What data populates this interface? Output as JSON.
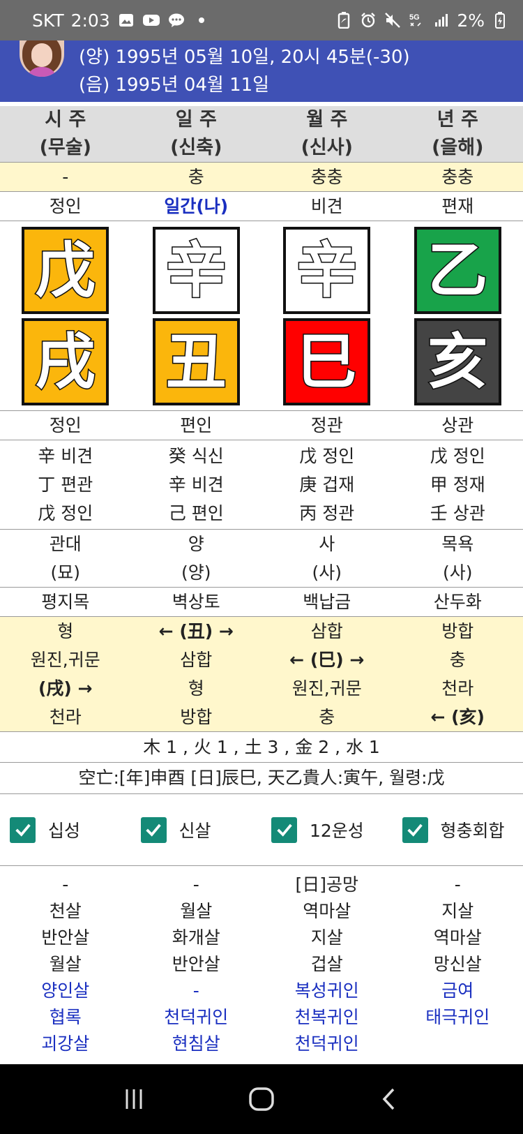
{
  "status": {
    "carrier": "SKT",
    "time": "2:03",
    "battery": "2%",
    "icons_left": [
      "image-icon",
      "youtube-icon",
      "chat-icon",
      "dot-icon"
    ],
    "icons_right": [
      "battery-saver-icon",
      "alarm-icon",
      "mute-icon",
      "5g-icon",
      "signal-icon",
      "battery-icon"
    ]
  },
  "header": {
    "solar": "(양) 1995년 05월 10일, 20시 45분(-30)",
    "lunar": "(음) 1995년 04월 11일"
  },
  "columns": [
    {
      "title": "시 주",
      "sub": "(무술)",
      "clash": "-",
      "stem_god": "정인",
      "stem": {
        "char": "戊",
        "color": "#fbb60c"
      },
      "branch": {
        "char": "戌",
        "color": "#fbb60c"
      },
      "branch_god": "정인",
      "hidden": [
        "辛 비견",
        "丁 편관",
        "戊 정인"
      ],
      "stage": "관대",
      "stage_sub": "(묘)",
      "nayin": "평지목",
      "relations": [
        "형",
        "원진,귀문",
        "(戌) →",
        "천라"
      ],
      "rel_bold": [
        false,
        false,
        true,
        false
      ],
      "sinsal_top": "-",
      "sinsal": [
        "천살",
        "반안살",
        "월살"
      ],
      "gwiin": [
        "양인살",
        "협록",
        "괴강살"
      ]
    },
    {
      "title": "일 주",
      "sub": "(신축)",
      "clash": "충",
      "stem_god": "일간(나)",
      "stem": {
        "char": "辛",
        "color": "#ffffff"
      },
      "branch": {
        "char": "丑",
        "color": "#fbb60c"
      },
      "branch_god": "편인",
      "hidden": [
        "癸 식신",
        "辛 비견",
        "己 편인"
      ],
      "stage": "양",
      "stage_sub": "(양)",
      "nayin": "벽상토",
      "relations": [
        "← (丑) →",
        "삼합",
        "형",
        "방합"
      ],
      "rel_bold": [
        true,
        false,
        false,
        false
      ],
      "sinsal_top": "-",
      "sinsal": [
        "월살",
        "화개살",
        "반안살"
      ],
      "gwiin": [
        "-",
        "천덕귀인",
        "현침살"
      ]
    },
    {
      "title": "월 주",
      "sub": "(신사)",
      "clash": "충충",
      "stem_god": "비견",
      "stem": {
        "char": "辛",
        "color": "#ffffff"
      },
      "branch": {
        "char": "巳",
        "color": "#ff0000"
      },
      "branch_god": "정관",
      "hidden": [
        "戊 정인",
        "庚 겁재",
        "丙 정관"
      ],
      "stage": "사",
      "stage_sub": "(사)",
      "nayin": "백납금",
      "relations": [
        "삼합",
        "← (巳) →",
        "원진,귀문",
        "충"
      ],
      "rel_bold": [
        false,
        true,
        false,
        false
      ],
      "sinsal_top": "[日]공망",
      "sinsal": [
        "역마살",
        "지살",
        "겁살"
      ],
      "gwiin": [
        "복성귀인",
        "천복귀인",
        "천덕귀인"
      ]
    },
    {
      "title": "년 주",
      "sub": "(을해)",
      "clash": "충충",
      "stem_god": "편재",
      "stem": {
        "char": "乙",
        "color": "#18a34a"
      },
      "branch": {
        "char": "亥",
        "color": "#444444"
      },
      "branch_god": "상관",
      "hidden": [
        "戊 정인",
        "甲 정재",
        "壬 상관"
      ],
      "stage": "목욕",
      "stage_sub": "(사)",
      "nayin": "산두화",
      "relations": [
        "방합",
        "충",
        "천라",
        "← (亥)"
      ],
      "rel_bold": [
        false,
        false,
        false,
        true
      ],
      "sinsal_top": "-",
      "sinsal": [
        "지살",
        "역마살",
        "망신살"
      ],
      "gwiin": [
        "금여",
        "태극귀인",
        ""
      ]
    }
  ],
  "elements_summary": "木 1 , 火 1 , 土 3 , 金 2 , 水 1",
  "extra_info": "空亡:[年]申酉 [日]辰巳, 天乙貴人:寅午, 월령:戊",
  "checkboxes": [
    {
      "label": "십성",
      "checked": true
    },
    {
      "label": "신살",
      "checked": true
    },
    {
      "label": "12운성",
      "checked": true
    },
    {
      "label": "형충회합",
      "checked": true
    }
  ],
  "colors": {
    "header": "#3f51b5",
    "checkbox": "#148a77",
    "highlight": "#fff7cc",
    "blue_text": "#1a2fc0"
  }
}
